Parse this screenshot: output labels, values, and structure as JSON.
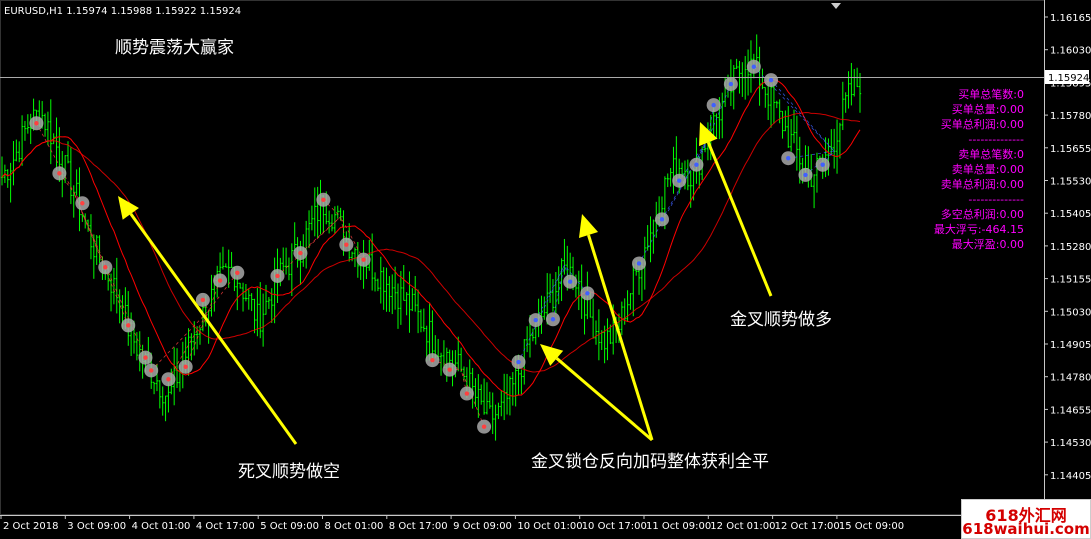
{
  "chart_header": "EURUSD,H1  1.15974 1.15988 1.15922 1.15924",
  "ea_title": "顺势震荡大赢家",
  "annotations": {
    "death_cross": "死叉顺势做空",
    "lock_hedge": "金叉锁仓反向加码整体获利全平",
    "golden_cross": "金叉顺势做多"
  },
  "stats_panel": {
    "buy": [
      "买单总笔数:0",
      "买单总量:0.00",
      "买单总利润:0.00"
    ],
    "separator": "--------------",
    "sell": [
      "卖单总笔数:0",
      "卖单总量:0.00",
      "卖单总利润:0.00"
    ],
    "summary": [
      "多空总利润:0.00",
      "最大浮亏:-464.15",
      "最大浮盈:0.00"
    ]
  },
  "colors": {
    "up_candle": "#00ff00",
    "ma": "#ff0000",
    "stats_text": "#ff00ff",
    "arrow": "#ffff00",
    "bid_line": "#aaaaaa",
    "trade_dot_fill": "#a8a8a8"
  },
  "watermark": {
    "line1": "618外汇网",
    "line2": "618waihui.com"
  },
  "chart_data": {
    "type": "candlestick",
    "symbol": "EURUSD",
    "timeframe": "H1",
    "current_price_label": "1.15924",
    "price_ticks": [
      "1.16165",
      "1.16030",
      "1.15895",
      "1.15780",
      "1.15655",
      "1.15530",
      "1.15405",
      "1.15280",
      "1.15155",
      "1.15030",
      "1.14905",
      "1.14780",
      "1.14655",
      "1.14530",
      "1.14405"
    ],
    "ylim": [
      1.1436,
      1.1623
    ],
    "time_ticks": [
      "2 Oct 2018",
      "3 Oct 09:00",
      "4 Oct 01:00",
      "4 Oct 17:00",
      "5 Oct 09:00",
      "8 Oct 01:00",
      "8 Oct 17:00",
      "9 Oct 09:00",
      "10 Oct 01:00",
      "10 Oct 17:00",
      "11 Oct 09:00",
      "12 Oct 01:00",
      "12 Oct 17:00",
      "15 Oct 09:00"
    ],
    "close_path": [
      1.1555,
      1.1563,
      1.1575,
      1.158,
      1.157,
      1.1557,
      1.1545,
      1.153,
      1.152,
      1.151,
      1.1495,
      1.1485,
      1.1478,
      1.147,
      1.1482,
      1.1495,
      1.1505,
      1.1515,
      1.152,
      1.151,
      1.15,
      1.151,
      1.152,
      1.1525,
      1.1535,
      1.1545,
      1.154,
      1.153,
      1.1525,
      1.152,
      1.1515,
      1.151,
      1.1505,
      1.1498,
      1.149,
      1.1485,
      1.148,
      1.147,
      1.1462,
      1.1465,
      1.1475,
      1.149,
      1.15,
      1.151,
      1.152,
      1.1515,
      1.15,
      1.1492,
      1.1495,
      1.151,
      1.1525,
      1.154,
      1.1555,
      1.156,
      1.1555,
      1.157,
      1.158,
      1.159,
      1.16,
      1.1595,
      1.1585,
      1.1575,
      1.1565,
      1.1555,
      1.156,
      1.157,
      1.1585,
      1.1592
    ]
  }
}
